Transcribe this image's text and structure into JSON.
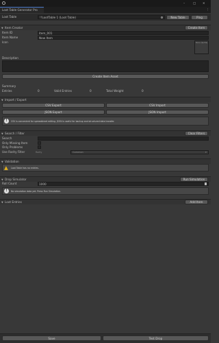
{
  "window": {
    "tab_title": "Loot Table Generator Pro",
    "min_glyph": "–",
    "max_glyph": "□",
    "close_glyph": "✕",
    "menu_glyph": "⋮"
  },
  "loot_table": {
    "label": "Loot Table",
    "value": "!!LootTable 1 (Loot Table)",
    "new_label": "New Table",
    "ping_label": "Ping"
  },
  "item_creator": {
    "title": "Item Creator",
    "create_btn": "Create Item",
    "id_label": "Item ID",
    "id_value": "item_001",
    "name_label": "Item Name",
    "name_value": "New Item",
    "icon_label": "Icon",
    "icon_hint": "None (Sprite)",
    "desc_label": "Description",
    "create_asset_btn": "Create Item Asset"
  },
  "summary": {
    "title": "Summary",
    "entries_label": "Entries",
    "entries_value": "0",
    "valid_label": "Valid Entries",
    "valid_value": "0",
    "weight_label": "Total Weight",
    "weight_value": "0"
  },
  "import_export": {
    "title": "Import / Export",
    "csv_export": "CSV Export",
    "csv_import": "CSV Import",
    "json_export": "JSON Export",
    "json_import": "JSON Import",
    "info": "CSV is convenient for spreadsheet editing. JSON is useful for backup and structured data transfer."
  },
  "search": {
    "title": "Search / Filter",
    "clear_btn": "Clear Filters",
    "search_label": "Search",
    "missing_label": "Only Missing Item",
    "problems_label": "Only Problems",
    "rarity_label": "Use Rarity Filter",
    "rarity_sub": "Rarity",
    "rarity_value": "Common"
  },
  "validation": {
    "title": "Validation",
    "warning": "Loot Table has no entries."
  },
  "drop_sim": {
    "title": "Drop Simulator",
    "run_btn": "Run Simulation",
    "roll_label": "Roll Count",
    "roll_value": "1000",
    "info": "No simulation data yet. Press Run Simulation."
  },
  "loot_entries": {
    "title": "Loot Entries",
    "add_btn": "Add Item"
  },
  "footer": {
    "save": "Save",
    "test": "Test Drop"
  },
  "colors": {
    "bg": "#383838",
    "field": "#242424",
    "button": "#585858",
    "accent": "#4a78c8",
    "warning": "#e0b020"
  }
}
